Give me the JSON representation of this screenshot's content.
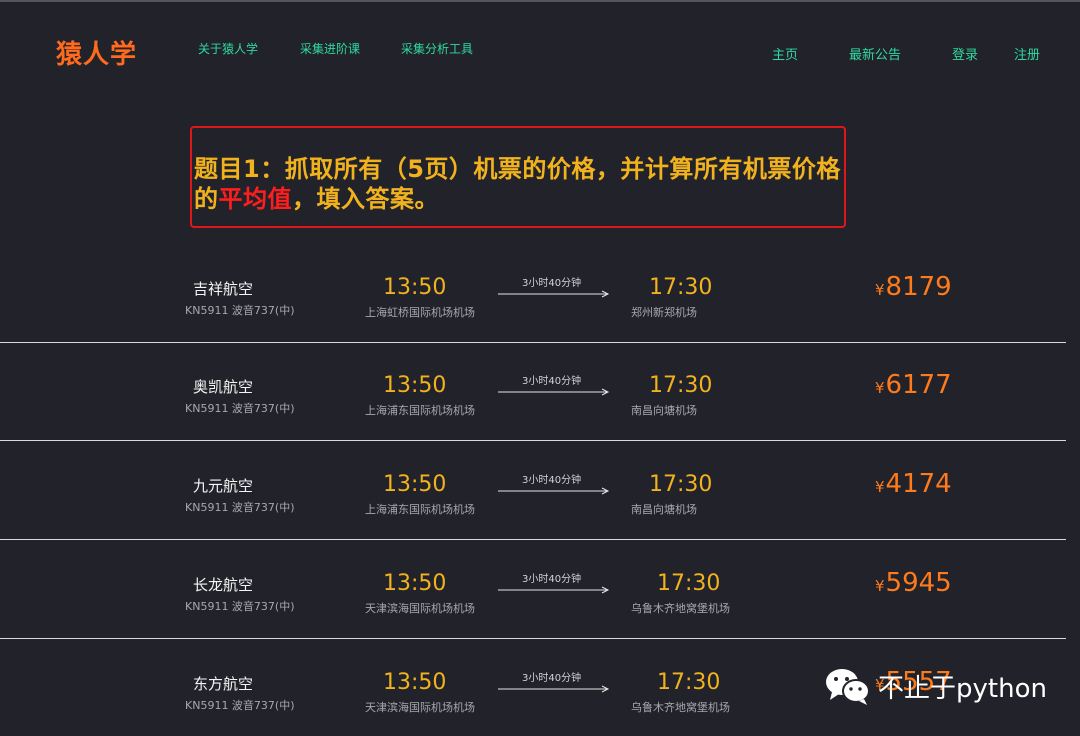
{
  "header": {
    "logo": "猿人学",
    "nav_left": [
      "关于猿人学",
      "采集进阶课",
      "采集分析工具"
    ],
    "nav_right": [
      "主页",
      "最新公告",
      "登录",
      "注册"
    ]
  },
  "question": {
    "before": "题目1：抓取所有（5页）机票的价格，并计算所有机票价格的",
    "highlight": "平均值",
    "after": "，填入答案。"
  },
  "flights": [
    {
      "airline": "吉祥航空",
      "flight_no": "KN5911 波音737(中)",
      "dep_time": "13:50",
      "dep_airport": "上海虹桥国际机场机场",
      "duration": "3小时40分钟",
      "arr_time": "17:30",
      "arr_airport": "郑州新郑机场",
      "currency": "¥",
      "price": "8179"
    },
    {
      "airline": "奥凯航空",
      "flight_no": "KN5911 波音737(中)",
      "dep_time": "13:50",
      "dep_airport": "上海浦东国际机场机场",
      "duration": "3小时40分钟",
      "arr_time": "17:30",
      "arr_airport": "南昌向塘机场",
      "currency": "¥",
      "price": "6177"
    },
    {
      "airline": "九元航空",
      "flight_no": "KN5911 波音737(中)",
      "dep_time": "13:50",
      "dep_airport": "上海浦东国际机场机场",
      "duration": "3小时40分钟",
      "arr_time": "17:30",
      "arr_airport": "南昌向塘机场",
      "currency": "¥",
      "price": "4174"
    },
    {
      "airline": "长龙航空",
      "flight_no": "KN5911 波音737(中)",
      "dep_time": "13:50",
      "dep_airport": "天津滨海国际机场机场",
      "duration": "3小时40分钟",
      "arr_time": "17:30",
      "arr_airport": "乌鲁木齐地窝堡机场",
      "currency": "¥",
      "price": "5945"
    },
    {
      "airline": "东方航空",
      "flight_no": "KN5911 波音737(中)",
      "dep_time": "13:50",
      "dep_airport": "天津滨海国际机场机场",
      "duration": "3小时40分钟",
      "arr_time": "17:30",
      "arr_airport": "乌鲁木齐地窝堡机场",
      "currency": "¥",
      "price": "5557"
    }
  ],
  "watermark": {
    "icon": "wechat-icon",
    "text": "不止于python"
  },
  "colors": {
    "background": "#22232a",
    "logo": "#ff6a1c",
    "nav": "#2fd9a0",
    "question": "#f2b21e",
    "highlight": "#ff1e1e",
    "border": "#e0161a",
    "price": "#ff7a1a"
  }
}
